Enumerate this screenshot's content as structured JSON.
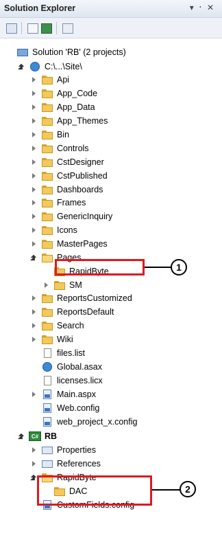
{
  "panel": {
    "title": "Solution Explorer",
    "controls": "▾ ᛫ ✕"
  },
  "toolbar": {
    "buttons": [
      "properties-icon",
      "show-all-files-icon",
      "refresh-icon",
      "view-class-diagram-icon"
    ]
  },
  "tree": [
    {
      "label": "Solution 'RB' (2 projects)",
      "icon": "solution-icon",
      "arrow": "none"
    },
    {
      "label": "C:\\...\\Site\\",
      "icon": "website-icon",
      "arrow": "expanded"
    },
    {
      "label": "Api",
      "icon": "folder-icon",
      "arrow": "collapsed"
    },
    {
      "label": "App_Code",
      "icon": "folder-icon",
      "arrow": "collapsed"
    },
    {
      "label": "App_Data",
      "icon": "folder-icon",
      "arrow": "collapsed"
    },
    {
      "label": "App_Themes",
      "icon": "folder-icon",
      "arrow": "collapsed"
    },
    {
      "label": "Bin",
      "icon": "folder-icon",
      "arrow": "collapsed"
    },
    {
      "label": "Controls",
      "icon": "folder-icon",
      "arrow": "collapsed"
    },
    {
      "label": "CstDesigner",
      "icon": "folder-icon",
      "arrow": "collapsed"
    },
    {
      "label": "CstPublished",
      "icon": "folder-icon",
      "arrow": "collapsed"
    },
    {
      "label": "Dashboards",
      "icon": "folder-icon",
      "arrow": "collapsed"
    },
    {
      "label": "Frames",
      "icon": "folder-icon",
      "arrow": "collapsed"
    },
    {
      "label": "GenericInquiry",
      "icon": "folder-icon",
      "arrow": "collapsed"
    },
    {
      "label": "Icons",
      "icon": "folder-icon",
      "arrow": "collapsed"
    },
    {
      "label": "MasterPages",
      "icon": "folder-icon",
      "arrow": "collapsed"
    },
    {
      "label": "Pages",
      "icon": "folder-open-icon",
      "arrow": "expanded"
    },
    {
      "label": "RapidByte",
      "icon": "folder-icon",
      "arrow": "none"
    },
    {
      "label": "SM",
      "icon": "folder-icon",
      "arrow": "collapsed"
    },
    {
      "label": "ReportsCustomized",
      "icon": "folder-icon",
      "arrow": "collapsed"
    },
    {
      "label": "ReportsDefault",
      "icon": "folder-icon",
      "arrow": "collapsed"
    },
    {
      "label": "Search",
      "icon": "folder-icon",
      "arrow": "collapsed"
    },
    {
      "label": "Wiki",
      "icon": "folder-icon",
      "arrow": "collapsed"
    },
    {
      "label": "files.list",
      "icon": "file-icon",
      "arrow": "none"
    },
    {
      "label": "Global.asax",
      "icon": "global-asax-icon",
      "arrow": "none"
    },
    {
      "label": "licenses.licx",
      "icon": "file-icon",
      "arrow": "none"
    },
    {
      "label": "Main.aspx",
      "icon": "aspx-file-icon",
      "arrow": "collapsed"
    },
    {
      "label": "Web.config",
      "icon": "config-file-icon",
      "arrow": "none"
    },
    {
      "label": "web_project_x.config",
      "icon": "config-file-icon",
      "arrow": "none"
    },
    {
      "label": "RB",
      "icon": "csharp-project-icon",
      "arrow": "expanded"
    },
    {
      "label": "Properties",
      "icon": "properties-icon",
      "arrow": "collapsed"
    },
    {
      "label": "References",
      "icon": "references-icon",
      "arrow": "collapsed"
    },
    {
      "label": "RapidByte",
      "icon": "folder-open-icon",
      "arrow": "expanded"
    },
    {
      "label": "DAC",
      "icon": "folder-icon",
      "arrow": "none"
    },
    {
      "label": "CustomFields.config",
      "icon": "config-file-icon",
      "arrow": "none"
    }
  ],
  "callouts": [
    {
      "number": "1"
    },
    {
      "number": "2"
    }
  ]
}
